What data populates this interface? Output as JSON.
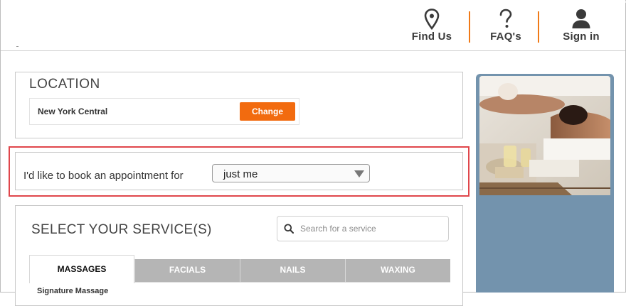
{
  "header": {
    "nav": [
      {
        "label": "Find Us",
        "icon": "map-pin-icon"
      },
      {
        "label": "FAQ's",
        "icon": "question-mark-icon"
      },
      {
        "label": "Sign in",
        "icon": "user-icon"
      }
    ]
  },
  "location": {
    "title": "LOCATION",
    "name": "New York Central",
    "change_label": "Change"
  },
  "booking": {
    "label": "I'd like to book an appointment for",
    "selected": "just me"
  },
  "services": {
    "title": "SELECT YOUR SERVICE(S)",
    "search_placeholder": "Search for a service",
    "tabs": [
      "MASSAGES",
      "FACIALS",
      "NAILS",
      "WAXING"
    ],
    "first_item": "Signature Massage"
  },
  "colors": {
    "accent": "#f26b0f",
    "highlight": "#e0464b",
    "side": "#7393ad",
    "tab_inactive": "#b5b5b5"
  }
}
